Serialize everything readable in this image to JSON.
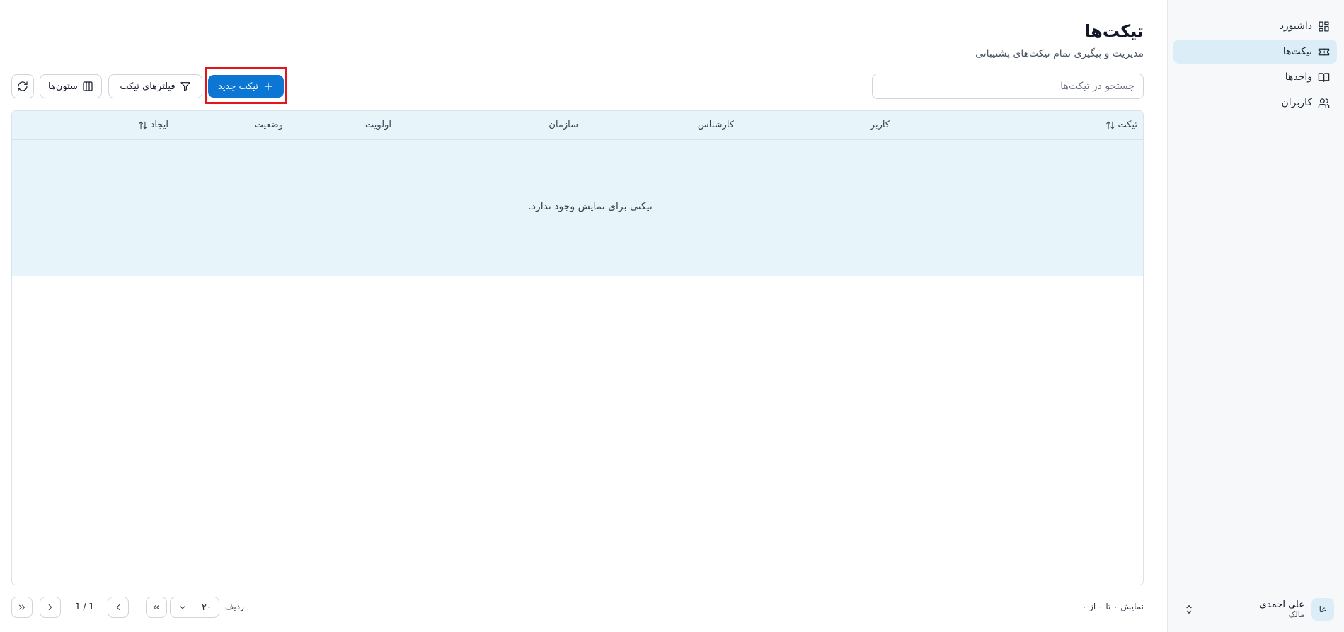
{
  "sidebar": {
    "items": [
      {
        "label": "داشبورد",
        "icon": "dashboard-icon"
      },
      {
        "label": "تیکت‌ها",
        "icon": "ticket-icon",
        "active": true
      },
      {
        "label": "واحدها",
        "icon": "book-icon"
      },
      {
        "label": "کاربران",
        "icon": "users-icon"
      }
    ],
    "user": {
      "initials": "عا",
      "name": "علی احمدی",
      "role": "مالک"
    }
  },
  "header": {
    "title": "تیکت‌ها",
    "subtitle": "مدیریت و پیگیری تمام تیکت‌های پشتیبانی"
  },
  "toolbar": {
    "search_placeholder": "جستجو در تیکت‌ها",
    "new_ticket_label": "تیکت جدید",
    "filters_label": "فیلترهای تیکت",
    "columns_label": "ستون‌ها"
  },
  "table": {
    "columns": [
      "تیکت",
      "کاربر",
      "کارشناس",
      "سازمان",
      "اولویت",
      "وضعیت",
      "ایجاد"
    ],
    "empty_message": "تیکتی برای نمایش وجود ندارد."
  },
  "pagination": {
    "summary": "نمایش ۰ تا ۰ از ۰",
    "rows_label": "ردیف",
    "rows_value": "۲۰",
    "page_info": "1 / 1"
  },
  "colors": {
    "accent": "#0b76d4",
    "highlight": "#e3161c",
    "header_bg": "#e7f4fa"
  }
}
